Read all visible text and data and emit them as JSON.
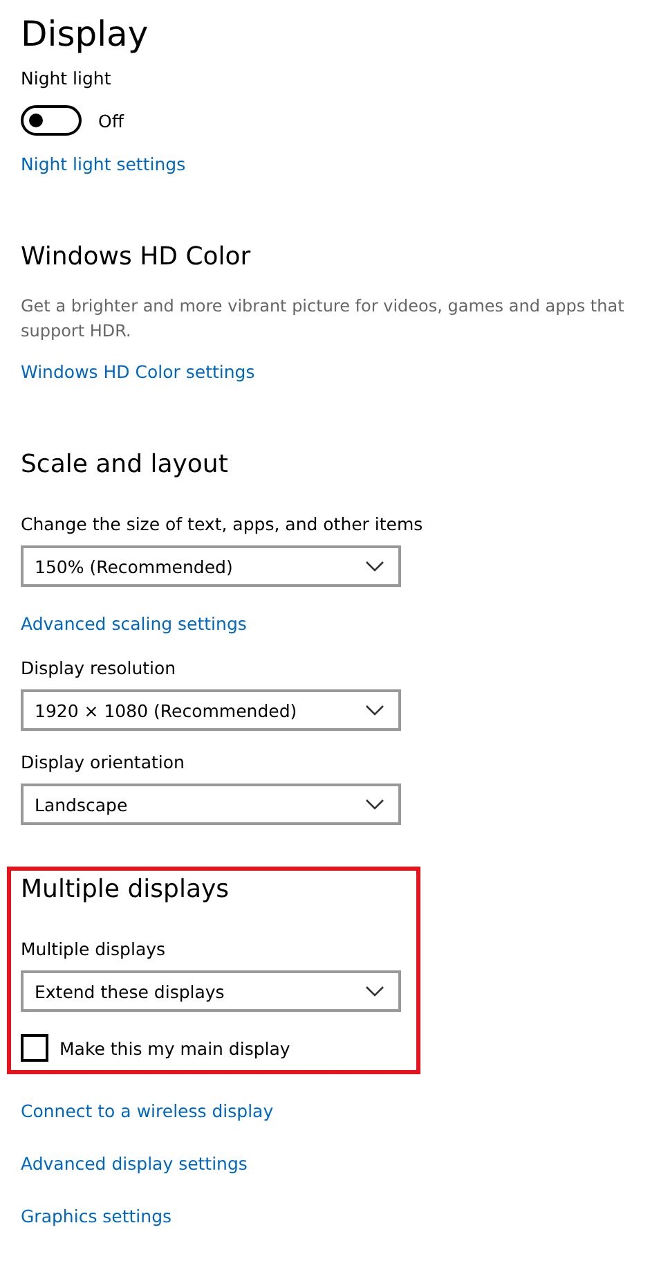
{
  "title": "Display",
  "sections": [
    {
      "highlighted": false,
      "items": [
        {
          "kind": "label",
          "text": "Night light"
        },
        {
          "kind": "toggle",
          "on": false,
          "text": "Off"
        },
        {
          "kind": "link",
          "text": "Night light settings"
        }
      ]
    },
    {
      "heading": "Windows HD Color",
      "highlighted": false,
      "items": [
        {
          "kind": "text",
          "text": "Get a brighter and more vibrant picture for videos, games and apps that support HDR."
        },
        {
          "kind": "link",
          "text": "Windows HD Color settings"
        }
      ]
    },
    {
      "heading": "Scale and layout",
      "highlighted": false,
      "items": [
        {
          "kind": "label",
          "text": "Change the size of text, apps, and other items"
        },
        {
          "kind": "dropdown",
          "text": "150% (Recommended)"
        },
        {
          "kind": "link",
          "text": "Advanced scaling settings"
        },
        {
          "kind": "label",
          "text": "Display resolution"
        },
        {
          "kind": "dropdown",
          "text": "1920 × 1080 (Recommended)"
        },
        {
          "kind": "label",
          "text": "Display orientation"
        },
        {
          "kind": "dropdown",
          "text": "Landscape"
        }
      ]
    },
    {
      "heading": "Multiple displays",
      "highlighted": true,
      "items": [
        {
          "kind": "label",
          "text": "Multiple displays"
        },
        {
          "kind": "dropdown",
          "text": "Extend these displays"
        },
        {
          "kind": "checkbox",
          "checked": false,
          "text": "Make this my main display"
        }
      ]
    },
    {
      "highlighted": false,
      "items": [
        {
          "kind": "link",
          "text": "Connect to a wireless display"
        },
        {
          "kind": "link",
          "text": "Advanced display settings"
        },
        {
          "kind": "link",
          "text": "Graphics settings"
        }
      ]
    }
  ]
}
